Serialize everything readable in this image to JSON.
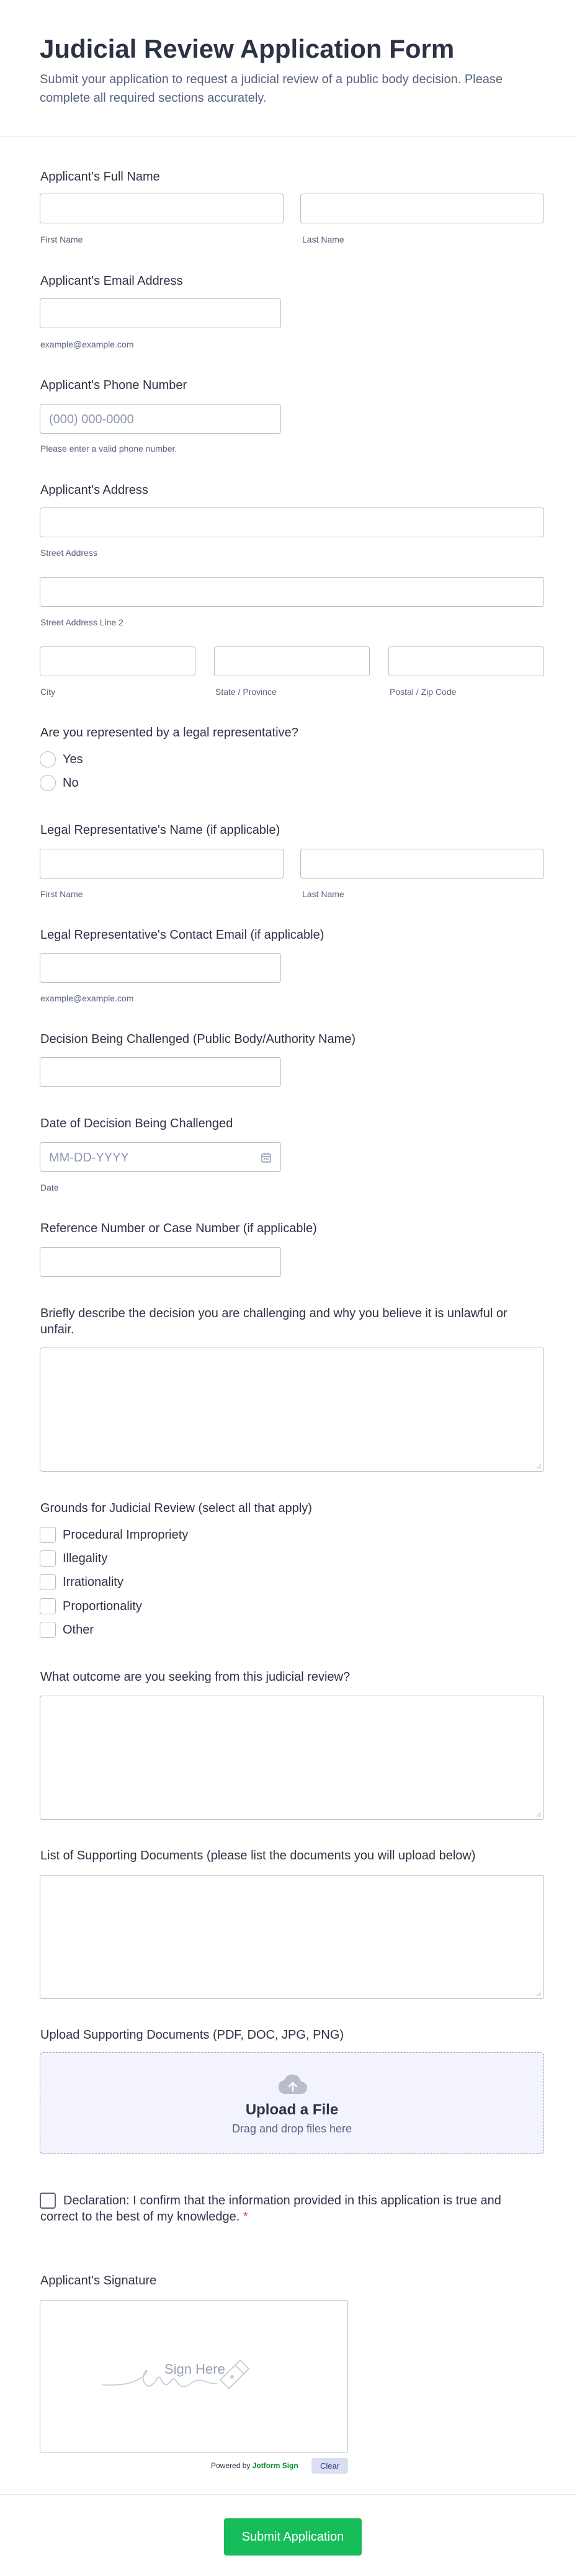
{
  "form": {
    "title": "Judicial Review Application Form",
    "subtitle": "Submit your application to request a judicial review of a public body decision. Please complete all required sections accurately."
  },
  "applicant_name": {
    "label": "Applicant's Full Name",
    "first": "First Name",
    "last": "Last Name"
  },
  "applicant_email": {
    "label": "Applicant's Email Address",
    "sub": "example@example.com"
  },
  "applicant_phone": {
    "label": "Applicant's Phone Number",
    "placeholder": "(000) 000-0000",
    "sub": "Please enter a valid phone number."
  },
  "address": {
    "label": "Applicant's Address",
    "street": "Street Address",
    "street2": "Street Address Line 2",
    "city": "City",
    "state": "State / Province",
    "zip": "Postal / Zip Code"
  },
  "representation": {
    "label": "Are you represented by a legal representative?",
    "options": [
      "Yes",
      "No"
    ]
  },
  "rep_name": {
    "label": "Legal Representative's Name (if applicable)",
    "first": "First Name",
    "last": "Last Name"
  },
  "rep_email": {
    "label": "Legal Representative's Contact Email (if applicable)",
    "sub": "example@example.com"
  },
  "decision_body": {
    "label": "Decision Being Challenged (Public Body/Authority Name)"
  },
  "decision_date": {
    "label": "Date of Decision Being Challenged",
    "placeholder": "MM-DD-YYYY",
    "sub": "Date"
  },
  "reference": {
    "label": "Reference Number or Case Number (if applicable)"
  },
  "description": {
    "label": "Briefly describe the decision you are challenging and why you believe it is unlawful or unfair."
  },
  "grounds": {
    "label": "Grounds for Judicial Review (select all that apply)",
    "options": [
      "Procedural Impropriety",
      "Illegality",
      "Irrationality",
      "Proportionality",
      "Other"
    ]
  },
  "outcome": {
    "label": "What outcome are you seeking from this judicial review?"
  },
  "documents_list": {
    "label": "List of Supporting Documents (please list the documents you will upload below)"
  },
  "upload": {
    "label": "Upload Supporting Documents (PDF, DOC, JPG, PNG)",
    "title": "Upload a File",
    "sub": "Drag and drop files here"
  },
  "declaration": {
    "text": "Declaration: I confirm that the information provided in this application is true and correct to the best of my knowledge.",
    "required_mark": "*"
  },
  "signature": {
    "label": "Applicant's Signature",
    "placeholder": "Sign Here",
    "powered_by": "Powered by",
    "brand": "Jotform Sign",
    "clear": "Clear"
  },
  "submit": {
    "label": "Submit Application"
  },
  "colors": {
    "submit": "#18bd5b",
    "required": "#f23a3c",
    "text": "#2c3345",
    "sub": "#57647e"
  }
}
